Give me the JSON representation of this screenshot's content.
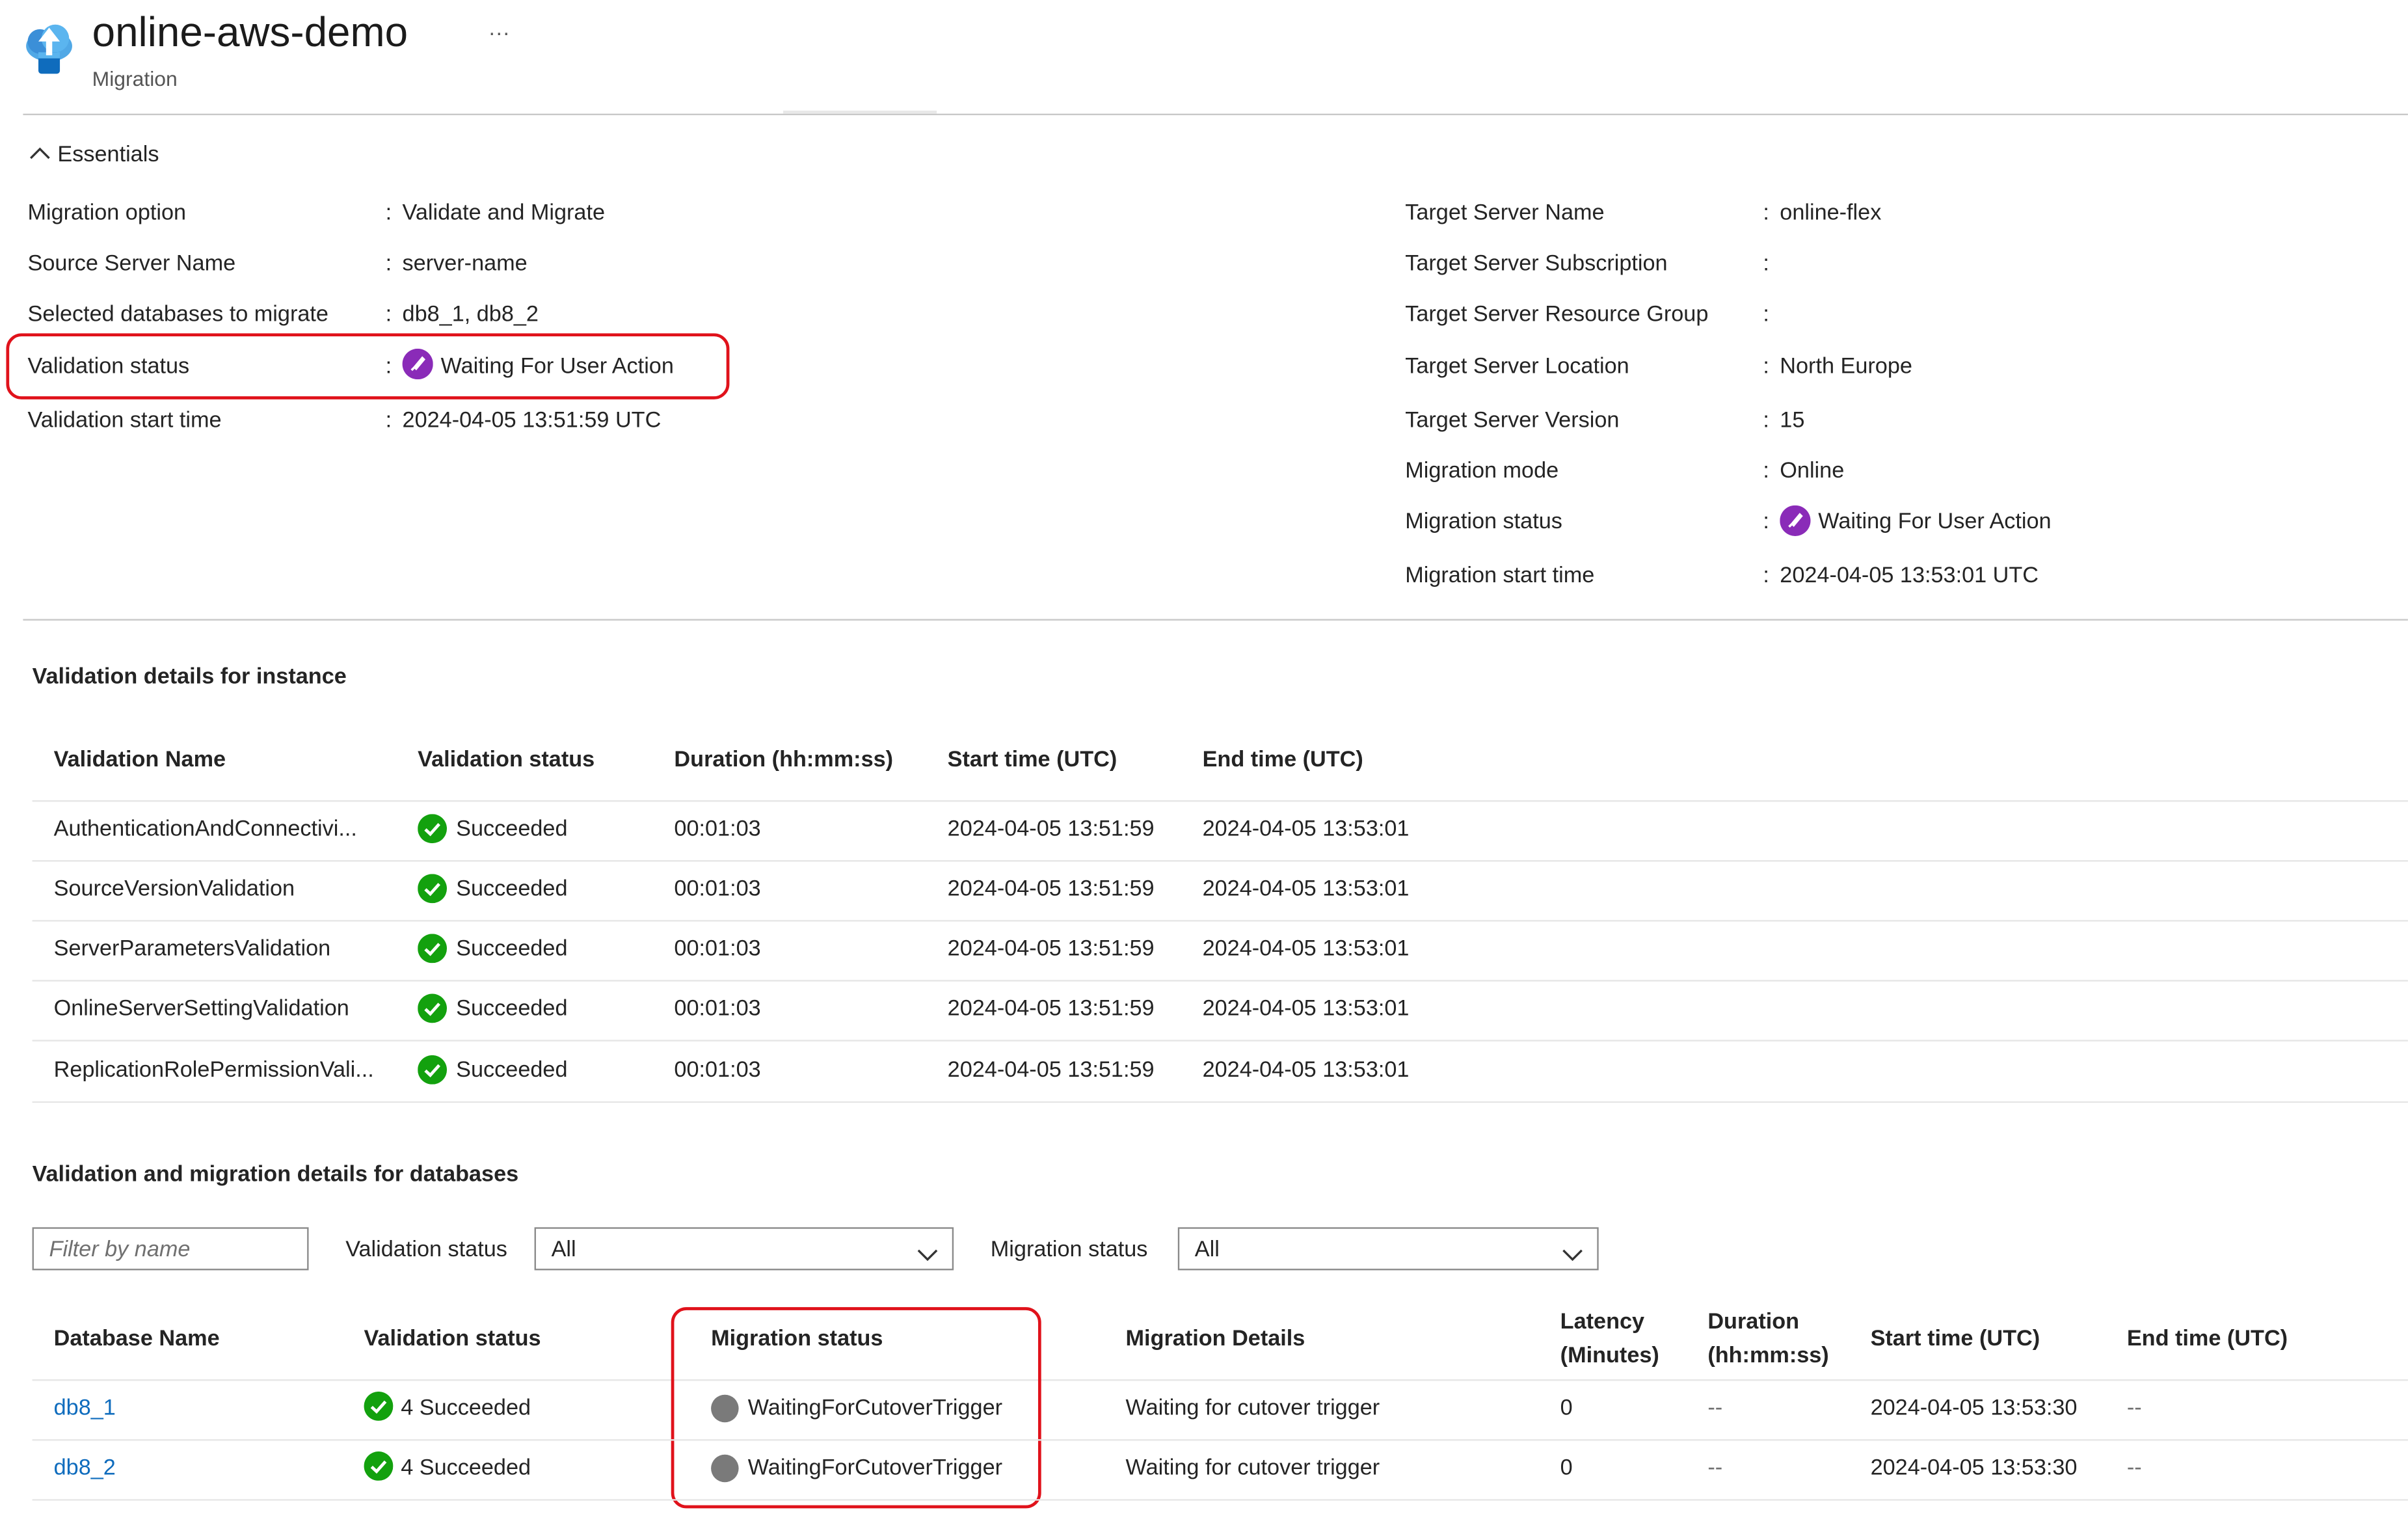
{
  "header": {
    "title": "online-aws-demo",
    "subtitle": "Migration",
    "more": "···"
  },
  "essentials": {
    "toggle_label": "Essentials",
    "separator": ":",
    "left": [
      {
        "label": "Migration option",
        "value": "Validate and Migrate"
      },
      {
        "label": "Source Server Name",
        "value": "server-name"
      },
      {
        "label": "Selected databases to migrate",
        "value": "db8_1, db8_2"
      },
      {
        "label": "Validation status",
        "value": "Waiting For User Action"
      },
      {
        "label": "Validation start time",
        "value": "2024-04-05 13:51:59 UTC"
      }
    ],
    "right": [
      {
        "label": "Target Server Name",
        "value": "online-flex"
      },
      {
        "label": "Target Server Subscription",
        "value": ""
      },
      {
        "label": "Target Server Resource Group",
        "value": ""
      },
      {
        "label": "Target Server Location",
        "value": "North Europe"
      },
      {
        "label": "Target Server Version",
        "value": "15"
      },
      {
        "label": "Migration mode",
        "value": "Online"
      },
      {
        "label": "Migration status",
        "value": "Waiting For User Action"
      },
      {
        "label": "Migration start time",
        "value": "2024-04-05 13:53:01 UTC"
      }
    ]
  },
  "instance": {
    "heading": "Validation details for instance",
    "columns": [
      "Validation Name",
      "Validation status",
      "Duration (hh:mm:ss)",
      "Start time (UTC)",
      "End time (UTC)"
    ],
    "rows": [
      {
        "name": "AuthenticationAndConnectivi...",
        "status": "Succeeded",
        "duration": "00:01:03",
        "start": "2024-04-05 13:51:59",
        "end": "2024-04-05 13:53:01"
      },
      {
        "name": "SourceVersionValidation",
        "status": "Succeeded",
        "duration": "00:01:03",
        "start": "2024-04-05 13:51:59",
        "end": "2024-04-05 13:53:01"
      },
      {
        "name": "ServerParametersValidation",
        "status": "Succeeded",
        "duration": "00:01:03",
        "start": "2024-04-05 13:51:59",
        "end": "2024-04-05 13:53:01"
      },
      {
        "name": "OnlineServerSettingValidation",
        "status": "Succeeded",
        "duration": "00:01:03",
        "start": "2024-04-05 13:51:59",
        "end": "2024-04-05 13:53:01"
      },
      {
        "name": "ReplicationRolePermissionVali...",
        "status": "Succeeded",
        "duration": "00:01:03",
        "start": "2024-04-05 13:51:59",
        "end": "2024-04-05 13:53:01"
      }
    ]
  },
  "databases": {
    "heading": "Validation and migration details for databases",
    "filter_placeholder": "Filter by name",
    "validation_filter_label": "Validation status",
    "validation_filter_value": "All",
    "migration_filter_label": "Migration status",
    "migration_filter_value": "All",
    "columns": {
      "name": "Database Name",
      "validation": "Validation status",
      "migration": "Migration status",
      "details": "Migration Details",
      "latency_1": "Latency",
      "latency_2": "(Minutes)",
      "duration_1": "Duration",
      "duration_2": "(hh:mm:ss)",
      "start": "Start time (UTC)",
      "end": "End time (UTC)"
    },
    "rows": [
      {
        "name": "db8_1",
        "validation": "4 Succeeded",
        "migration": "WaitingForCutoverTrigger",
        "details": "Waiting for cutover trigger",
        "latency": "0",
        "duration": "--",
        "start": "2024-04-05 13:53:30",
        "end": "--"
      },
      {
        "name": "db8_2",
        "validation": "4 Succeeded",
        "migration": "WaitingForCutoverTrigger",
        "details": "Waiting for cutover trigger",
        "latency": "0",
        "duration": "--",
        "start": "2024-04-05 13:53:30",
        "end": "--"
      }
    ]
  },
  "colors": {
    "link": "#0f6cbd",
    "success": "#13a10e",
    "waiting": "#8a2bb8",
    "highlight": "#e0121b",
    "neutral_status": "#7a7a7a"
  }
}
